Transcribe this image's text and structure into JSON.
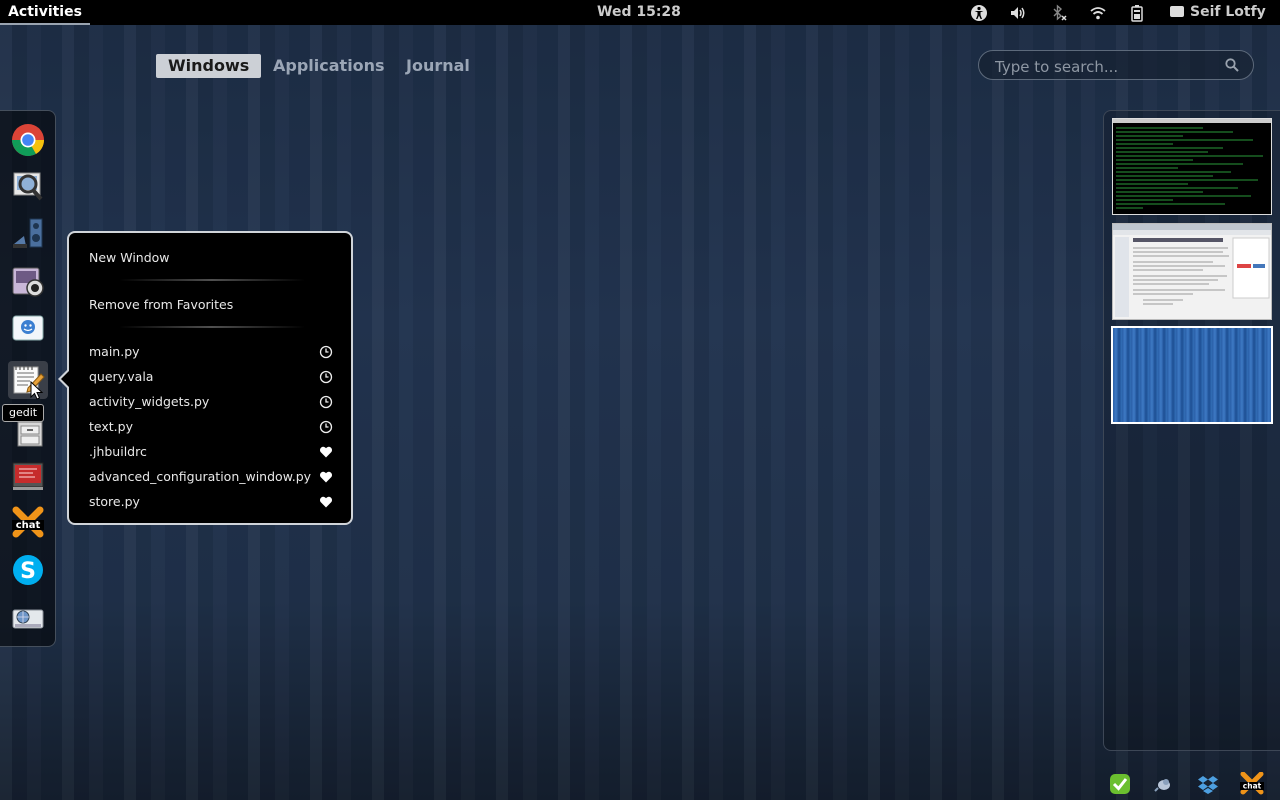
{
  "top_panel": {
    "activities_label": "Activities",
    "clock": "Wed 15:28",
    "user_name": "Seif Lotfy",
    "status_icons": [
      "accessibility-icon",
      "volume-icon",
      "bluetooth-disabled-icon",
      "wifi-icon",
      "battery-icon",
      "chat-status-icon"
    ]
  },
  "view_selector": {
    "tabs": [
      {
        "label": "Windows",
        "active": true
      },
      {
        "label": "Applications",
        "active": false
      },
      {
        "label": "Journal",
        "active": false
      }
    ]
  },
  "search": {
    "placeholder": "Type to search...",
    "value": ""
  },
  "dash": {
    "apps": [
      {
        "name": "chrome",
        "icon": "chrome-icon"
      },
      {
        "name": "image-viewer",
        "icon": "magnifier-photo-icon"
      },
      {
        "name": "music-app",
        "icon": "music-icon"
      },
      {
        "name": "webcam-app",
        "icon": "webcam-icon"
      },
      {
        "name": "chat-app",
        "icon": "chat-bubble-icon"
      },
      {
        "name": "gedit",
        "icon": "text-editor-icon"
      },
      {
        "name": "file-cabinet",
        "icon": "file-cabinet-icon"
      },
      {
        "name": "presentation",
        "icon": "presentation-icon"
      },
      {
        "name": "xchat",
        "icon": "xchat-icon"
      },
      {
        "name": "skype",
        "icon": "skype-icon"
      },
      {
        "name": "network-app",
        "icon": "globe-drive-icon"
      }
    ],
    "tooltip": "gedit"
  },
  "popup_menu": {
    "new_window": "New Window",
    "remove_favorites": "Remove from Favorites",
    "files": [
      {
        "name": "main.py",
        "icon": "recent-clock-icon"
      },
      {
        "name": "query.vala",
        "icon": "recent-clock-icon"
      },
      {
        "name": "activity_widgets.py",
        "icon": "recent-clock-icon"
      },
      {
        "name": "text.py",
        "icon": "recent-clock-icon"
      },
      {
        "name": ".jhbuildrc",
        "icon": "heart-icon"
      },
      {
        "name": "advanced_configuration_window.py",
        "icon": "heart-icon"
      },
      {
        "name": "store.py",
        "icon": "heart-icon"
      }
    ]
  },
  "workspaces": [
    "terminal-workspace",
    "browser-workspace",
    "empty-workspace"
  ],
  "message_tray": [
    "update-check-icon",
    "pidgin-icon",
    "dropbox-icon",
    "xchat-tray-icon"
  ],
  "colors": {
    "panel": "#000000",
    "background": "#1f3049",
    "accent": "#ccd0d6"
  }
}
